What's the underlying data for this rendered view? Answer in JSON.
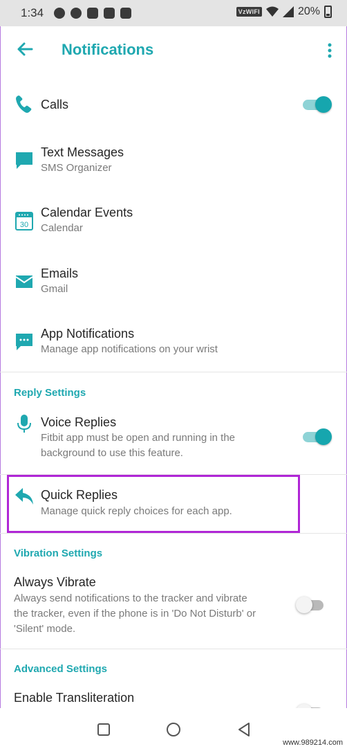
{
  "status": {
    "time": "1:34",
    "carrier": "VzWIFI",
    "battery": "20%"
  },
  "header": {
    "title": "Notifications"
  },
  "rows": [
    {
      "title": "Calls",
      "subtitle": "",
      "icon": "phone-icon",
      "toggle": true
    },
    {
      "title": "Text Messages",
      "subtitle": "SMS Organizer",
      "icon": "message-icon"
    },
    {
      "title": "Calendar Events",
      "subtitle": "Calendar",
      "icon": "calendar-icon",
      "icon_text": "30"
    },
    {
      "title": "Emails",
      "subtitle": "Gmail",
      "icon": "email-icon"
    },
    {
      "title": "App Notifications",
      "subtitle": "Manage app notifications on your wrist",
      "icon": "app-notification-icon"
    }
  ],
  "reply": {
    "section": "Reply Settings",
    "voice_title": "Voice Replies",
    "voice_sub1": "Fitbit app must be open and running in the",
    "voice_sub2": "background to use this feature.",
    "voice_toggle": true,
    "quick_title": "Quick Replies",
    "quick_sub": "Manage quick reply choices for each app."
  },
  "vibration": {
    "section": "Vibration Settings",
    "title": "Always Vibrate",
    "desc1": "Always send notifications to the tracker and vibrate",
    "desc2": "the tracker, even if the phone is in 'Do Not Disturb' or",
    "desc3": "'Silent' mode.",
    "toggle": false
  },
  "advanced": {
    "section": "Advanced Settings",
    "title": "Enable Transliteration"
  },
  "watermark": "www.989214.com",
  "colors": {
    "accent": "#1fa8b0",
    "highlight": "#b026d6"
  }
}
